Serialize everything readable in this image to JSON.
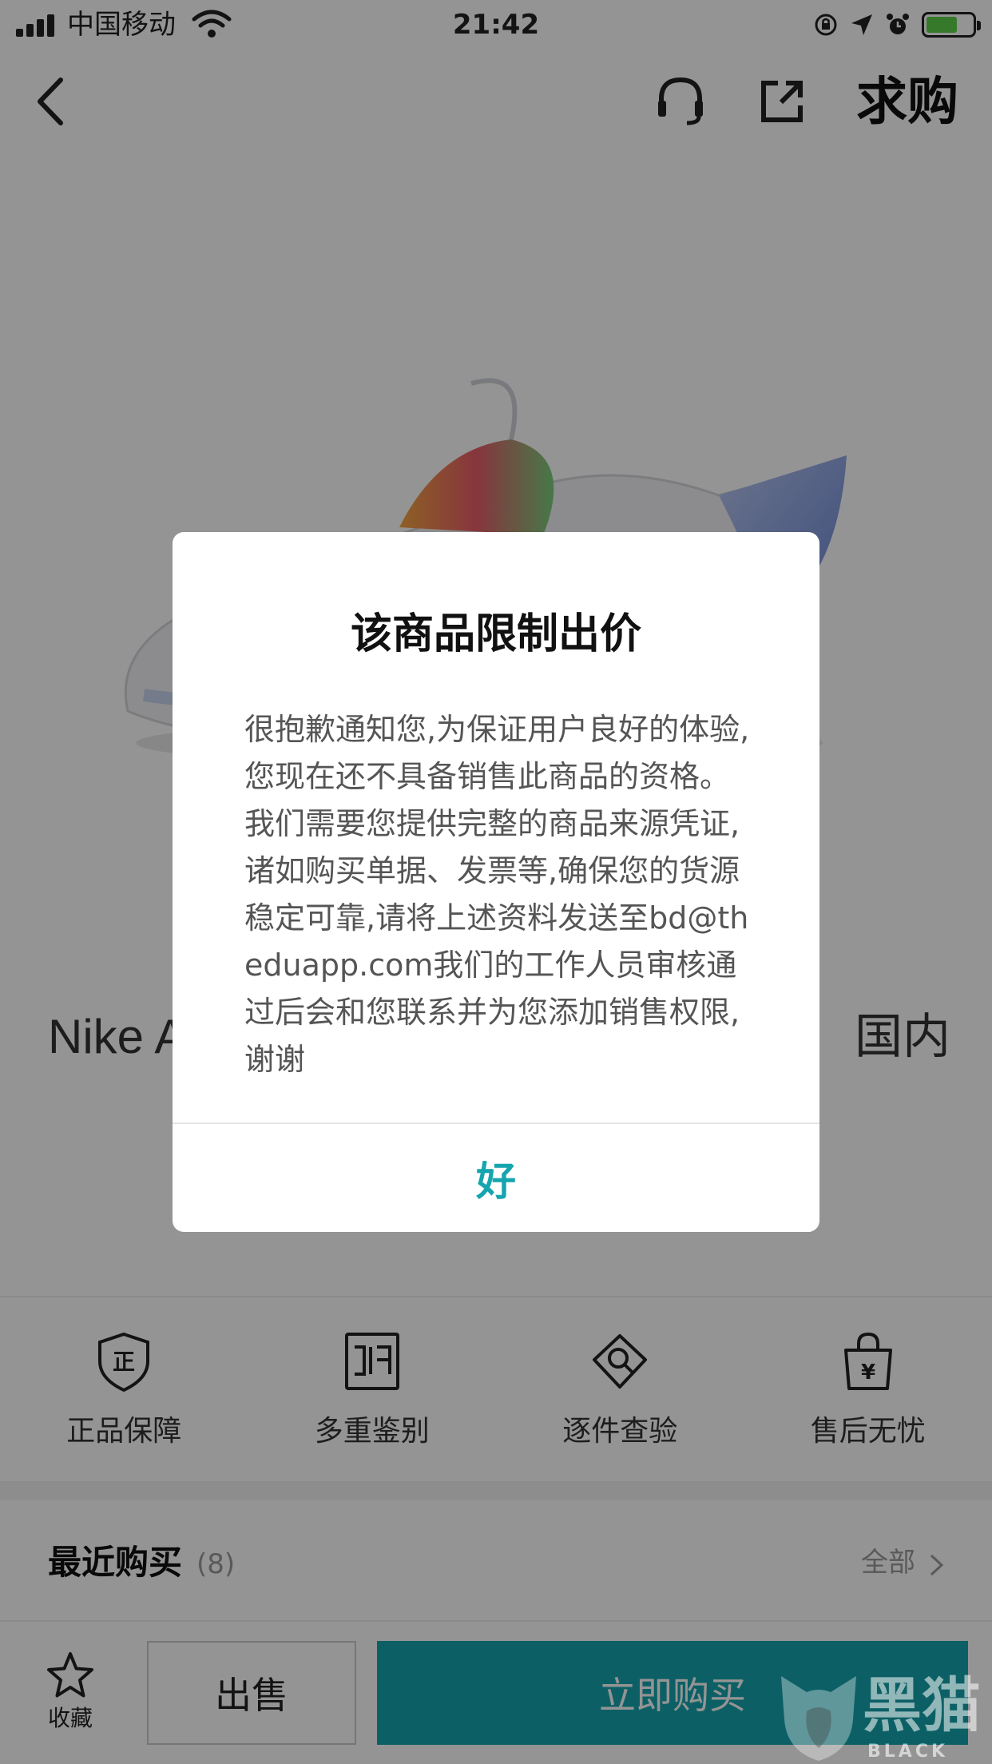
{
  "status_bar": {
    "carrier": "中国移动",
    "time": "21:42"
  },
  "nav": {
    "want_label": "求购"
  },
  "product": {
    "title_start": "Nike A",
    "title_end": "国内"
  },
  "guarantees": [
    {
      "label": "正品保障",
      "icon": "authentic-shield-icon"
    },
    {
      "label": "多重鉴别",
      "icon": "multi-appraisal-icon"
    },
    {
      "label": "逐件查验",
      "icon": "inspect-icon"
    },
    {
      "label": "售后无忧",
      "icon": "aftersale-bag-icon"
    }
  ],
  "guarantee_icon_glyphs": {
    "shield": "正",
    "bag": "¥"
  },
  "recent": {
    "title": "最近购买",
    "count": "(8)",
    "all_label": "全部"
  },
  "bottom_bar": {
    "favorite_label": "收藏",
    "sell_label": "出售",
    "buy_label": "立即购买"
  },
  "dialog": {
    "title": "该商品限制出价",
    "message": "很抱歉通知您,为保证用户良好的体验,您现在还不具备销售此商品的资格。我们需要您提供完整的商品来源凭证,诸如购买单据、发票等,确保您的货源稳定可靠,请将上述资料发送至bd@theduapp.com我们的工作人员审核通过后会和您联系并为您添加销售权限,谢谢",
    "ok_label": "好"
  },
  "watermark": {
    "cn": "黑猫",
    "en": "BLACK CAT"
  },
  "colors": {
    "accent": "#16a5af",
    "overlay": "rgba(0,0,0,0.42)"
  }
}
